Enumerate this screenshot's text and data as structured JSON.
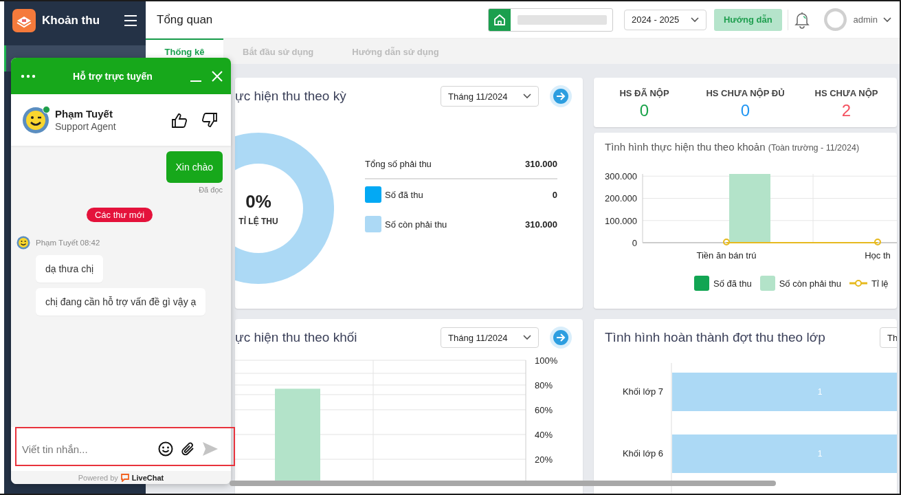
{
  "sidebar": {
    "title": "Khoản thu"
  },
  "header": {
    "title": "Tổng quan",
    "year_select": "2024 - 2025",
    "guide_button": "Hướng dẫn",
    "user": "admin"
  },
  "tabs": [
    {
      "label": "Thống kê",
      "selected": true
    },
    {
      "label": "Bắt đầu sử dụng",
      "selected": false
    },
    {
      "label": "Hướng dẫn sử dụng",
      "selected": false
    }
  ],
  "period_card": {
    "title": "ực hiện thu theo kỳ",
    "period_select": "Tháng 11/2024",
    "rate": "0%",
    "rate_label": "TỈ LỆ THU",
    "total": {
      "label": "Tổng số phải thu",
      "value": "310.000"
    },
    "legend": [
      {
        "value": "0",
        "color": "#03a9f4"
      },
      {
        "value": "310.000",
        "color": "#acd9f5"
      }
    ],
    "chart_data": {
      "type": "donut",
      "categories": [
        "Số đã thu",
        "Số còn phải thu"
      ],
      "values": [
        0,
        100
      ]
    }
  },
  "stats": [
    {
      "label": "HS ĐÃ NỘP",
      "value": "0",
      "color": "#1aa34a"
    },
    {
      "label": "HS CHƯA NỘP ĐỦ",
      "value": "0",
      "color": "#2196f3"
    },
    {
      "label": "HS CHƯA NỘP",
      "value": "2",
      "color": "#f4515f"
    }
  ],
  "item_card": {
    "title": "Tình hình thực hiện thu theo khoản",
    "subtitle": "(Toàn trường - 11/2024)",
    "chart_data": {
      "type": "bar",
      "categories": [
        "Tiền ăn bán trú",
        "Học th"
      ],
      "ylim": [
        0,
        310000
      ],
      "grid": true,
      "yticks": [
        {
          "value": 0,
          "label": "0"
        },
        {
          "value": 100000,
          "label": "100.000"
        },
        {
          "value": 200000,
          "label": "200.000"
        },
        {
          "value": 300000,
          "label": "300.000"
        }
      ],
      "series": [
        {
          "name": "Số đã thu",
          "color": "#12a553",
          "type": "bar",
          "values": [
            0,
            0
          ]
        },
        {
          "name": "Số còn phải thu",
          "color": "#b3e3c9",
          "type": "bar",
          "values": [
            310000,
            null
          ]
        },
        {
          "name": "Tỉ lệ",
          "color": "#e6b91e",
          "type": "line",
          "marker": "o",
          "values": [
            0,
            0
          ]
        }
      ]
    }
  },
  "grade_card": {
    "title": "ực hiện thu theo khối",
    "period_select": "Tháng 11/2024",
    "chart_data": {
      "type": "bar",
      "ylim": [
        0,
        100
      ],
      "grid": true,
      "yticks": [
        {
          "value": 20,
          "label": "20%"
        },
        {
          "value": 40,
          "label": "40%"
        },
        {
          "value": 60,
          "label": "60%"
        },
        {
          "value": 80,
          "label": "80%"
        },
        {
          "value": 100,
          "label": "100%"
        }
      ],
      "values": [
        77
      ]
    }
  },
  "class_card": {
    "title": "Tình hình hoàn thành đợt thu theo lớp",
    "period_select": "Th",
    "chart_data": {
      "type": "bar",
      "orientation": "horizontal",
      "categories": [
        "Khối lớp 7",
        "Khối lớp 6"
      ],
      "values": [
        1,
        1
      ],
      "data_labels": true
    }
  },
  "chat": {
    "title": "Hỗ trợ trực tuyến",
    "agent": {
      "name": "Phạm Tuyết",
      "role": "Support Agent",
      "online": true
    },
    "messages": [
      {
        "kind": "outgoing",
        "text": "Xin chào",
        "status": "Đã đọc"
      },
      {
        "kind": "divider",
        "text": "Các thư mới"
      },
      {
        "kind": "sender",
        "text": "Phạm Tuyết 08:42"
      },
      {
        "kind": "incoming",
        "text": "dạ thưa chị"
      },
      {
        "kind": "incoming",
        "text": "chị đang cần hỗ trợ vấn đề gì vậy ạ"
      }
    ],
    "composer": {
      "placeholder": "Viết tin nhắn..."
    },
    "footer": {
      "prefix": "Powered by",
      "brand": "LiveChat"
    }
  }
}
